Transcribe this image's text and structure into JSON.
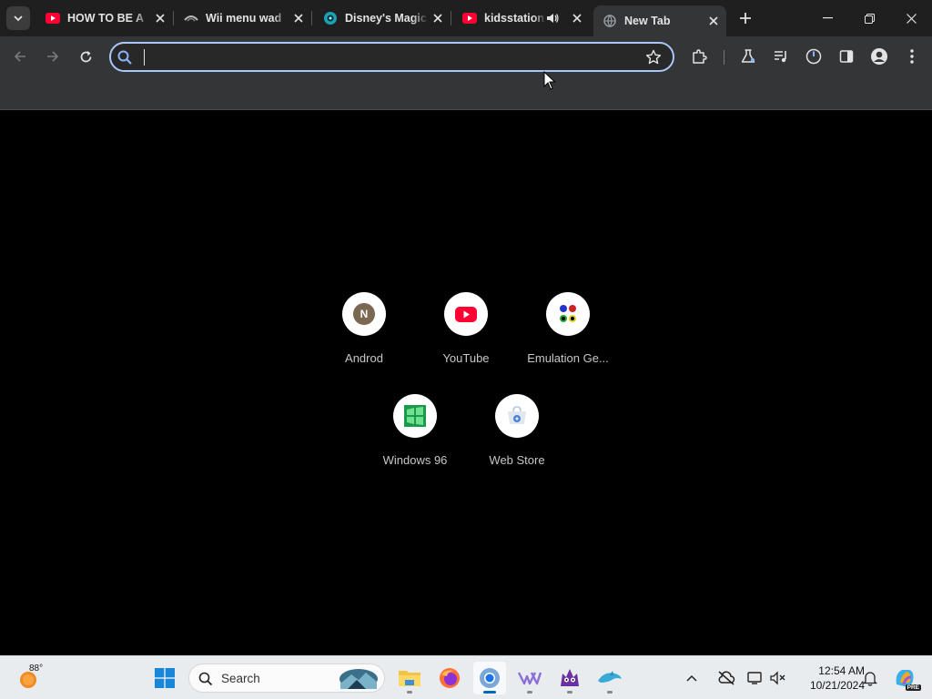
{
  "browser": {
    "tabs": [
      {
        "title": "HOW TO BE A",
        "favicon": "youtube-icon"
      },
      {
        "title": "Wii menu wad",
        "favicon": "wii-icon"
      },
      {
        "title": "Disney's Magic",
        "favicon": "disney-icon"
      },
      {
        "title": "kidsstation",
        "favicon": "youtube-icon",
        "audio": "speaker-icon"
      },
      {
        "title": "New Tab",
        "favicon": "globe-icon",
        "active": true
      }
    ],
    "omnibox": {
      "value": "",
      "placeholder": ""
    }
  },
  "shortcuts": [
    {
      "label": "Androd",
      "icon": "letter-n-icon",
      "letter": "N"
    },
    {
      "label": "YouTube",
      "icon": "youtube-icon"
    },
    {
      "label": "Emulation Ge...",
      "icon": "emulation-icon"
    },
    {
      "label": "Windows 96",
      "icon": "windows96-icon"
    },
    {
      "label": "Web Store",
      "icon": "webstore-icon"
    }
  ],
  "taskbar": {
    "weather_temp": "88°",
    "search_label": "Search",
    "time": "12:54 AM",
    "date": "10/21/2024",
    "copilot_badge": "PRE"
  },
  "colors": {
    "accent": "#a8c7fa",
    "tab_strip": "#1f1f1f",
    "toolbar": "#333537",
    "youtube_red": "#ff0033",
    "taskbar": "#e8ecef"
  }
}
